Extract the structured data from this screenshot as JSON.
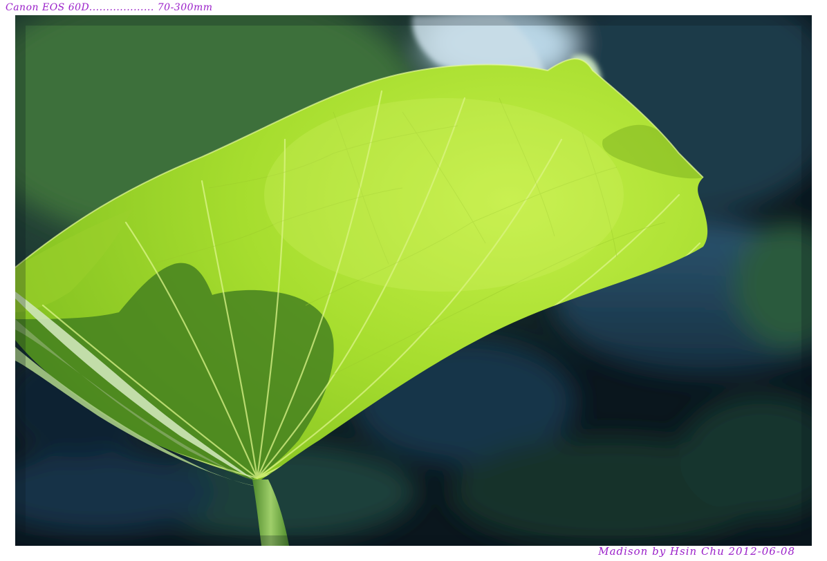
{
  "captions": {
    "top": "Canon EOS 60D................... 70-300mm",
    "bottom": "Madison by Hsin Chu 2012-06-08"
  },
  "colors": {
    "caption": "#9a1fc9",
    "leaf_light": "#b8e83a",
    "leaf_mid": "#8fcc25",
    "shadow": "#3f7a1e",
    "background_dark": "#0b1a22",
    "background_blue": "#1f3f55"
  }
}
